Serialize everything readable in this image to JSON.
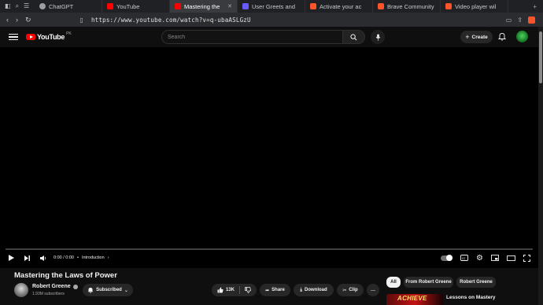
{
  "browser": {
    "tabs": [
      {
        "label": "ChatGPT",
        "color": "#9e9e9e"
      },
      {
        "label": "YouTube",
        "color": "#ff0000"
      },
      {
        "label": "Mastering the",
        "color": "#ff0000",
        "active": true
      },
      {
        "label": "User Greets and",
        "color": "#6b5bff"
      },
      {
        "label": "Activate your ac",
        "color": "#fb542b"
      },
      {
        "label": "Brave Community",
        "color": "#fb542b"
      },
      {
        "label": "Video player wil",
        "color": "#fb542b"
      }
    ],
    "url": "https://www.youtube.com/watch?v=q-ubaASLGzU"
  },
  "header": {
    "logo_text": "YouTube",
    "country_code": "PK",
    "search_placeholder": "Search",
    "create_label": "Create"
  },
  "player": {
    "time": "0:00 / 0:00",
    "chapter": "Introduction",
    "chapter_sep": "•",
    "progress_fraction": 0
  },
  "video": {
    "title": "Mastering the Laws of Power",
    "channel": "Robert Greene",
    "subscribers": "1.93M subscribers",
    "subscribed_label": "Subscribed",
    "likes": "13K",
    "share_label": "Share",
    "download_label": "Download",
    "clip_label": "Clip",
    "more_label": "…"
  },
  "sidebar": {
    "chips": [
      "All",
      "From Robert Greene",
      "Robert Greene"
    ],
    "recommendation": {
      "thumb_text": "ACHIEVE",
      "title": "Lessons on Mastery"
    }
  },
  "colors": {
    "accent": "#ff0000",
    "background": "#0f0f0f",
    "chip_active": "#f1f1f1"
  }
}
